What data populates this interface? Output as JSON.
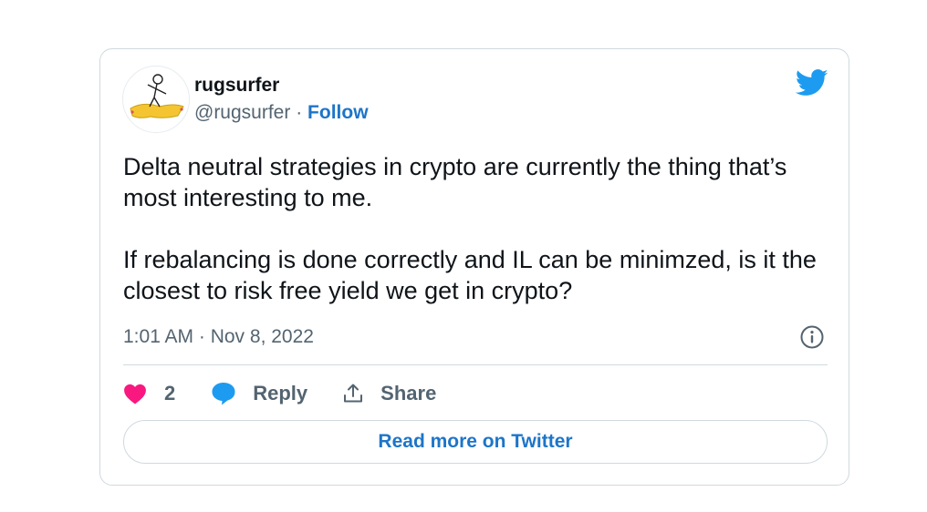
{
  "tweet": {
    "author_name": "rugsurfer",
    "author_handle": "@rugsurfer",
    "separator": "·",
    "follow_label": "Follow",
    "paragraphs": [
      "Delta neutral strategies in crypto are currently the thing that’s most interesting to me.",
      "If rebalancing is done correctly and IL can be minimzed, is it the closest to risk free yield we get in crypto?"
    ],
    "timestamp": "1:01 AM · Nov 8, 2022"
  },
  "actions": {
    "like_count": "2",
    "reply_label": "Reply",
    "share_label": "Share"
  },
  "read_more_label": "Read more on Twitter",
  "colors": {
    "brand": "#1d9bf0",
    "link": "#1d75c9",
    "like": "#f91880",
    "muted": "#536471",
    "border": "#cfd9de"
  },
  "icons": {
    "logo": "twitter-bird-icon",
    "info": "info-icon",
    "like": "heart-icon",
    "reply": "speech-bubble-icon",
    "share": "share-upload-icon"
  }
}
